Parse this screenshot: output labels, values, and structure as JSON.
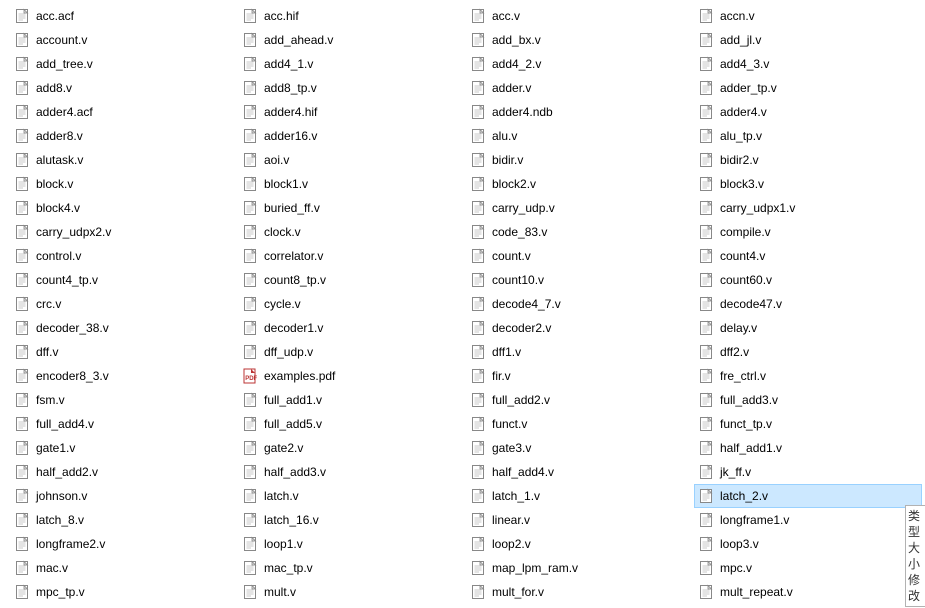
{
  "columns": [
    [
      {
        "name": "acc.acf",
        "icon": "file",
        "selected": false
      },
      {
        "name": "account.v",
        "icon": "file",
        "selected": false
      },
      {
        "name": "add_tree.v",
        "icon": "file",
        "selected": false
      },
      {
        "name": "add8.v",
        "icon": "file",
        "selected": false
      },
      {
        "name": "adder4.acf",
        "icon": "file",
        "selected": false
      },
      {
        "name": "adder8.v",
        "icon": "file",
        "selected": false
      },
      {
        "name": "alutask.v",
        "icon": "file",
        "selected": false
      },
      {
        "name": "block.v",
        "icon": "file",
        "selected": false
      },
      {
        "name": "block4.v",
        "icon": "file",
        "selected": false
      },
      {
        "name": "carry_udpx2.v",
        "icon": "file",
        "selected": false
      },
      {
        "name": "control.v",
        "icon": "file",
        "selected": false
      },
      {
        "name": "count4_tp.v",
        "icon": "file",
        "selected": false
      },
      {
        "name": "crc.v",
        "icon": "file",
        "selected": false
      },
      {
        "name": "decoder_38.v",
        "icon": "file",
        "selected": false
      },
      {
        "name": "dff.v",
        "icon": "file",
        "selected": false
      },
      {
        "name": "encoder8_3.v",
        "icon": "file",
        "selected": false
      },
      {
        "name": "fsm.v",
        "icon": "file",
        "selected": false
      },
      {
        "name": "full_add4.v",
        "icon": "file",
        "selected": false
      },
      {
        "name": "gate1.v",
        "icon": "file",
        "selected": false
      },
      {
        "name": "half_add2.v",
        "icon": "file",
        "selected": false
      },
      {
        "name": "johnson.v",
        "icon": "file",
        "selected": false
      },
      {
        "name": "latch_8.v",
        "icon": "file",
        "selected": false
      },
      {
        "name": "longframe2.v",
        "icon": "file",
        "selected": false
      },
      {
        "name": "mac.v",
        "icon": "file",
        "selected": false
      },
      {
        "name": "mpc_tp.v",
        "icon": "file",
        "selected": false
      }
    ],
    [
      {
        "name": "acc.hif",
        "icon": "file",
        "selected": false
      },
      {
        "name": "add_ahead.v",
        "icon": "file",
        "selected": false
      },
      {
        "name": "add4_1.v",
        "icon": "file",
        "selected": false
      },
      {
        "name": "add8_tp.v",
        "icon": "file",
        "selected": false
      },
      {
        "name": "adder4.hif",
        "icon": "file",
        "selected": false
      },
      {
        "name": "adder16.v",
        "icon": "file",
        "selected": false
      },
      {
        "name": "aoi.v",
        "icon": "file",
        "selected": false
      },
      {
        "name": "block1.v",
        "icon": "file",
        "selected": false
      },
      {
        "name": "buried_ff.v",
        "icon": "file",
        "selected": false
      },
      {
        "name": "clock.v",
        "icon": "file",
        "selected": false
      },
      {
        "name": "correlator.v",
        "icon": "file",
        "selected": false
      },
      {
        "name": "count8_tp.v",
        "icon": "file",
        "selected": false
      },
      {
        "name": "cycle.v",
        "icon": "file",
        "selected": false
      },
      {
        "name": "decoder1.v",
        "icon": "file",
        "selected": false
      },
      {
        "name": "dff_udp.v",
        "icon": "file",
        "selected": false
      },
      {
        "name": "examples.pdf",
        "icon": "pdf",
        "selected": false
      },
      {
        "name": "full_add1.v",
        "icon": "file",
        "selected": false
      },
      {
        "name": "full_add5.v",
        "icon": "file",
        "selected": false
      },
      {
        "name": "gate2.v",
        "icon": "file",
        "selected": false
      },
      {
        "name": "half_add3.v",
        "icon": "file",
        "selected": false
      },
      {
        "name": "latch.v",
        "icon": "file",
        "selected": false
      },
      {
        "name": "latch_16.v",
        "icon": "file",
        "selected": false
      },
      {
        "name": "loop1.v",
        "icon": "file",
        "selected": false
      },
      {
        "name": "mac_tp.v",
        "icon": "file",
        "selected": false
      },
      {
        "name": "mult.v",
        "icon": "file",
        "selected": false
      }
    ],
    [
      {
        "name": "acc.v",
        "icon": "file",
        "selected": false
      },
      {
        "name": "add_bx.v",
        "icon": "file",
        "selected": false
      },
      {
        "name": "add4_2.v",
        "icon": "file",
        "selected": false
      },
      {
        "name": "adder.v",
        "icon": "file",
        "selected": false
      },
      {
        "name": "adder4.ndb",
        "icon": "file",
        "selected": false
      },
      {
        "name": "alu.v",
        "icon": "file",
        "selected": false
      },
      {
        "name": "bidir.v",
        "icon": "file",
        "selected": false
      },
      {
        "name": "block2.v",
        "icon": "file",
        "selected": false
      },
      {
        "name": "carry_udp.v",
        "icon": "file",
        "selected": false
      },
      {
        "name": "code_83.v",
        "icon": "file",
        "selected": false
      },
      {
        "name": "count.v",
        "icon": "file",
        "selected": false
      },
      {
        "name": "count10.v",
        "icon": "file",
        "selected": false
      },
      {
        "name": "decode4_7.v",
        "icon": "file",
        "selected": false
      },
      {
        "name": "decoder2.v",
        "icon": "file",
        "selected": false
      },
      {
        "name": "dff1.v",
        "icon": "file",
        "selected": false
      },
      {
        "name": "fir.v",
        "icon": "file",
        "selected": false
      },
      {
        "name": "full_add2.v",
        "icon": "file",
        "selected": false
      },
      {
        "name": "funct.v",
        "icon": "file",
        "selected": false
      },
      {
        "name": "gate3.v",
        "icon": "file",
        "selected": false
      },
      {
        "name": "half_add4.v",
        "icon": "file",
        "selected": false
      },
      {
        "name": "latch_1.v",
        "icon": "file",
        "selected": false
      },
      {
        "name": "linear.v",
        "icon": "file",
        "selected": false
      },
      {
        "name": "loop2.v",
        "icon": "file",
        "selected": false
      },
      {
        "name": "map_lpm_ram.v",
        "icon": "file",
        "selected": false
      },
      {
        "name": "mult_for.v",
        "icon": "file",
        "selected": false
      }
    ],
    [
      {
        "name": "accn.v",
        "icon": "file",
        "selected": false
      },
      {
        "name": "add_jl.v",
        "icon": "file",
        "selected": false
      },
      {
        "name": "add4_3.v",
        "icon": "file",
        "selected": false
      },
      {
        "name": "adder_tp.v",
        "icon": "file",
        "selected": false
      },
      {
        "name": "adder4.v",
        "icon": "file",
        "selected": false
      },
      {
        "name": "alu_tp.v",
        "icon": "file",
        "selected": false
      },
      {
        "name": "bidir2.v",
        "icon": "file",
        "selected": false
      },
      {
        "name": "block3.v",
        "icon": "file",
        "selected": false
      },
      {
        "name": "carry_udpx1.v",
        "icon": "file",
        "selected": false
      },
      {
        "name": "compile.v",
        "icon": "file",
        "selected": false
      },
      {
        "name": "count4.v",
        "icon": "file",
        "selected": false
      },
      {
        "name": "count60.v",
        "icon": "file",
        "selected": false
      },
      {
        "name": "decode47.v",
        "icon": "file",
        "selected": false
      },
      {
        "name": "delay.v",
        "icon": "file",
        "selected": false
      },
      {
        "name": "dff2.v",
        "icon": "file",
        "selected": false
      },
      {
        "name": "fre_ctrl.v",
        "icon": "file",
        "selected": false
      },
      {
        "name": "full_add3.v",
        "icon": "file",
        "selected": false
      },
      {
        "name": "funct_tp.v",
        "icon": "file",
        "selected": false
      },
      {
        "name": "half_add1.v",
        "icon": "file",
        "selected": false
      },
      {
        "name": "jk_ff.v",
        "icon": "file",
        "selected": false
      },
      {
        "name": "latch_2.v",
        "icon": "file",
        "selected": true
      },
      {
        "name": "longframe1.v",
        "icon": "file",
        "selected": false
      },
      {
        "name": "loop3.v",
        "icon": "file",
        "selected": false
      },
      {
        "name": "mpc.v",
        "icon": "file",
        "selected": false
      },
      {
        "name": "mult_repeat.v",
        "icon": "file",
        "selected": false
      }
    ]
  ],
  "tooltip": {
    "line1": "类型",
    "line2": "大小",
    "line3": "修改"
  }
}
